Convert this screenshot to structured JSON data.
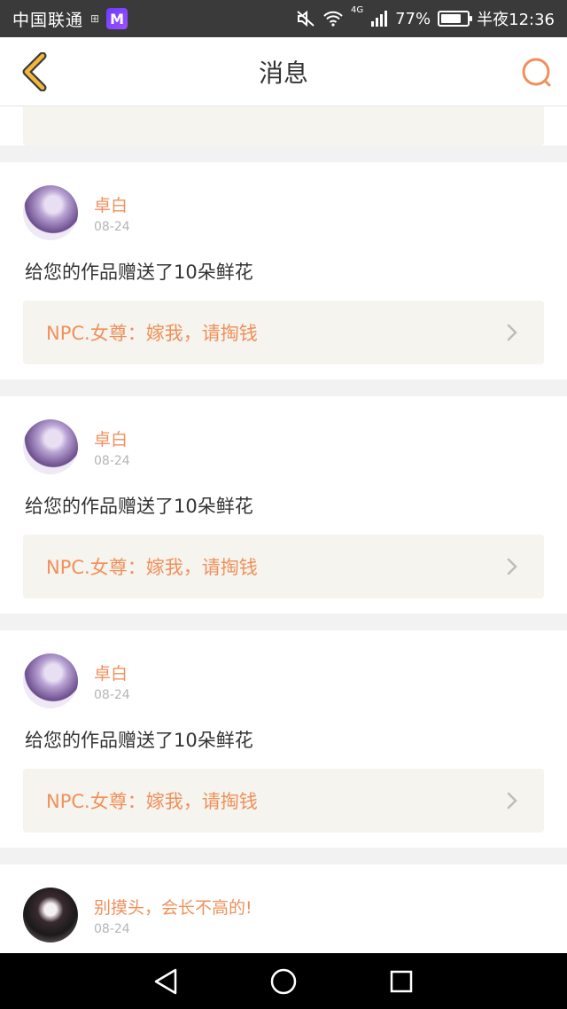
{
  "status_bar": {
    "carrier": "中国联通",
    "mini_icon": "⊞",
    "app_badge": "M",
    "network": "4G",
    "battery_percent": "77%",
    "battery_level": 0.77,
    "time": "半夜12:36"
  },
  "header": {
    "title": "消息"
  },
  "messages": [
    {
      "name": "卓白",
      "date": "08-24",
      "text": "给您的作品赠送了10朵鲜花",
      "quote": "NPC.女尊：嫁我，请掏钱"
    },
    {
      "name": "卓白",
      "date": "08-24",
      "text": "给您的作品赠送了10朵鲜花",
      "quote": "NPC.女尊：嫁我，请掏钱"
    },
    {
      "name": "卓白",
      "date": "08-24",
      "text": "给您的作品赠送了10朵鲜花",
      "quote": "NPC.女尊：嫁我，请掏钱"
    },
    {
      "name": "别摸头，会长不高的!",
      "date": "08-24"
    }
  ],
  "colors": {
    "accent": "#f0905b",
    "back_icon": "#f2b83a",
    "quote_bg": "#f5f4ee"
  }
}
